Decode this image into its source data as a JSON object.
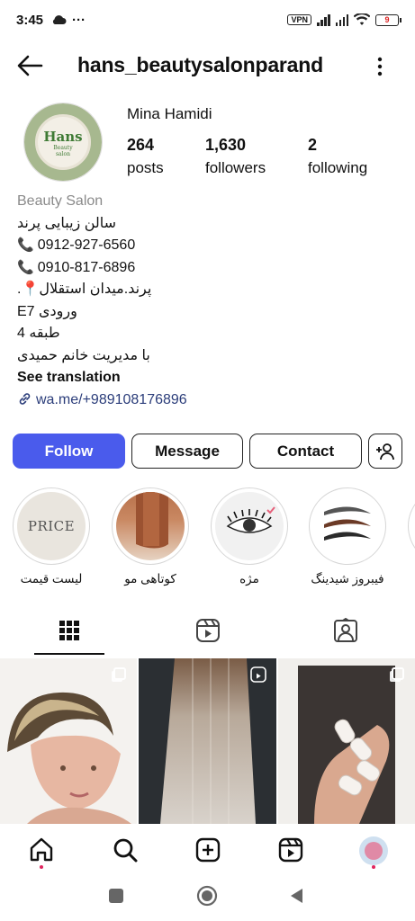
{
  "status_bar": {
    "time": "3:45",
    "dots": "···",
    "vpn": "VPN",
    "battery": "9"
  },
  "header": {
    "username": "hans_beautysalonparand"
  },
  "profile": {
    "avatar_logo": "Hans",
    "avatar_sub1": "Beauty",
    "avatar_sub2": "salon",
    "full_name": "Mina Hamidi",
    "posts_count": "264",
    "posts_label": "posts",
    "followers_count": "1,630",
    "followers_label": "followers",
    "following_count": "2",
    "following_label": "following"
  },
  "bio": {
    "category": "Beauty Salon",
    "line1": "سالن زیبایی پرند",
    "phone1": "0912-927-6560",
    "phone2": "0910-817-6896",
    "address": "پرند.میدان استقلال📍.",
    "entrance": "ورودی E7",
    "floor": "طبقه 4",
    "manager": "با مدیریت خانم حمیدی",
    "see_translation": "See translation",
    "link": "wa.me/+989108176896"
  },
  "actions": {
    "follow": "Follow",
    "message": "Message",
    "contact": "Contact"
  },
  "highlights": [
    {
      "label": "لیست قیمت",
      "cover_text": "PRICE"
    },
    {
      "label": "کوتاهی مو"
    },
    {
      "label": "مژه"
    },
    {
      "label": "فیبروز شیدینگ"
    }
  ],
  "tabs": [
    "grid-icon",
    "reels-icon",
    "tagged-icon"
  ],
  "colors": {
    "primary": "#4a5bec",
    "link": "#2b3d7a",
    "notify": "#e0245e"
  }
}
